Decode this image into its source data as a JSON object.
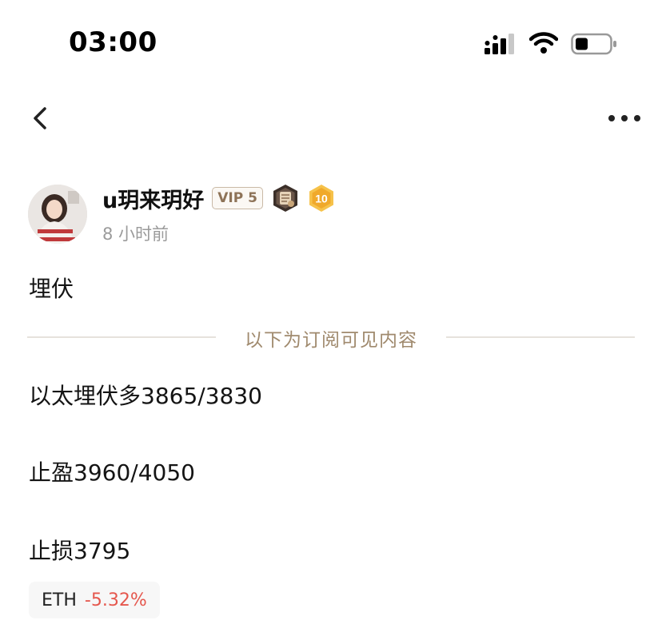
{
  "status_bar": {
    "time": "03:00"
  },
  "icons": {
    "back": "chevron-left-icon",
    "more": "more-dots-icon",
    "signal": "cellular-signal-icon",
    "wifi": "wifi-icon",
    "battery": "battery-icon",
    "medal": "medal-badge-icon",
    "level": "level-hexagon-icon"
  },
  "author": {
    "name": "u玥来玥好",
    "vip_label": "VIP 5",
    "level": "10",
    "posted_time": "8 小时前"
  },
  "post": {
    "title": "埋伏",
    "subscriber_divider": "以下为订阅可见内容",
    "lines": [
      "以太埋伏多3865/3830",
      "止盈3960/4050",
      "止损3795"
    ],
    "ticker": {
      "symbol": "ETH",
      "change": "-5.32%"
    }
  },
  "colors": {
    "vip_text": "#8e7358",
    "divider_text": "#a08a6e",
    "negative_change": "#e5574d",
    "level_badge": "#f0b33a"
  }
}
